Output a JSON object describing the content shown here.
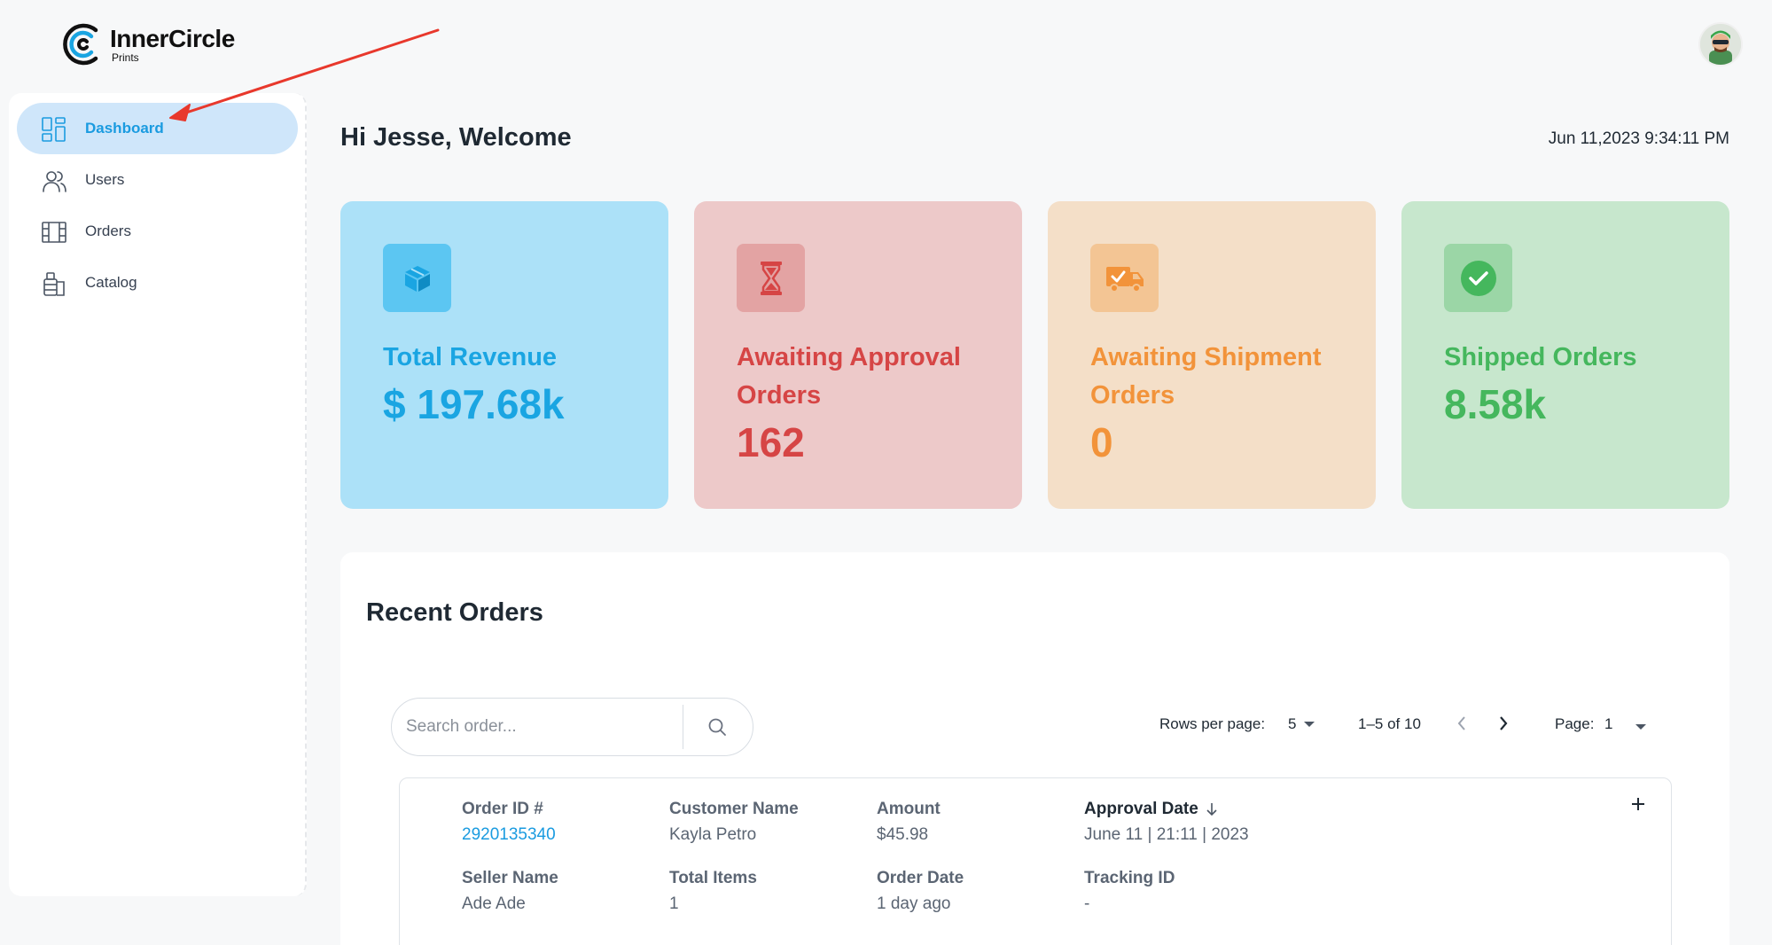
{
  "brand": {
    "name": "InnerCircle",
    "sub": "Prints"
  },
  "sidebar": {
    "items": [
      {
        "label": "Dashboard",
        "icon": "dashboard-icon",
        "active": true
      },
      {
        "label": "Users",
        "icon": "users-icon",
        "active": false
      },
      {
        "label": "Orders",
        "icon": "orders-icon",
        "active": false
      },
      {
        "label": "Catalog",
        "icon": "catalog-icon",
        "active": false
      }
    ]
  },
  "header": {
    "greeting": "Hi Jesse, Welcome",
    "datetime": "Jun 11,2023 9:34:11 PM"
  },
  "stats": [
    {
      "title": "Total Revenue",
      "value": "$ 197.68k",
      "icon": "box-icon",
      "color": "#1aa5e2"
    },
    {
      "title": "Awaiting Approval Orders",
      "value": "162",
      "icon": "hourglass-icon",
      "color": "#d64545"
    },
    {
      "title": "Awaiting Shipment Orders",
      "value": "0",
      "icon": "truck-icon",
      "color": "#f2933a"
    },
    {
      "title": "Shipped Orders",
      "value": "8.58k",
      "icon": "check-circle-icon",
      "color": "#45b75d"
    }
  ],
  "recent_orders": {
    "title": "Recent Orders",
    "search_placeholder": "Search order...",
    "rows_per_page_label": "Rows per page:",
    "rows_per_page_value": "5",
    "range": "1–5 of 10",
    "page_label": "Page:",
    "page_value": "1",
    "fields": {
      "order_id_label": "Order ID #",
      "customer_label": "Customer Name",
      "amount_label": "Amount",
      "approval_label": "Approval Date",
      "seller_label": "Seller Name",
      "items_label": "Total Items",
      "order_date_label": "Order Date",
      "tracking_label": "Tracking ID"
    },
    "rows": [
      {
        "order_id": "2920135340",
        "customer": "Kayla Petro",
        "amount": "$45.98",
        "approval_date": "June 11 | 21:11 | 2023",
        "seller": "Ade Ade",
        "total_items": "1",
        "order_date": "1 day ago",
        "tracking_id": "-"
      }
    ]
  },
  "colors": {
    "accent": "#1a9be0",
    "active_nav_bg": "#cfe6fa",
    "annotation": "#e8382c"
  }
}
